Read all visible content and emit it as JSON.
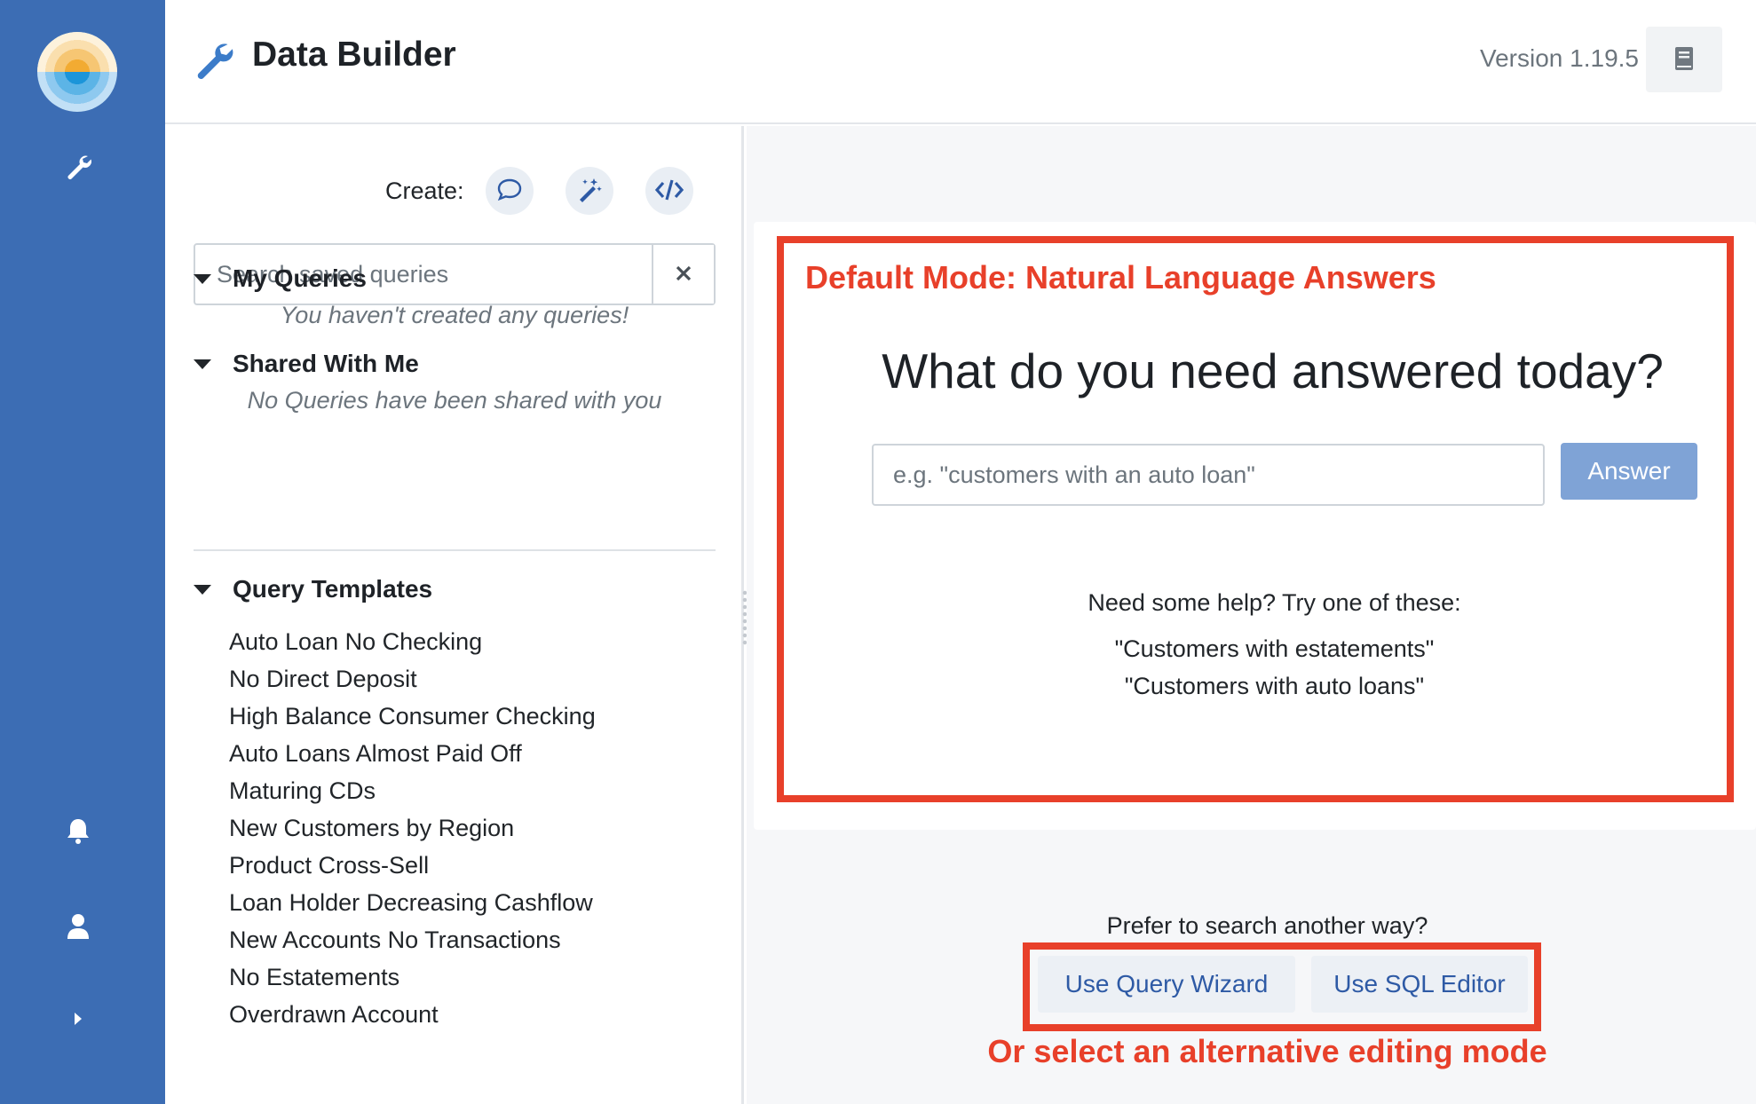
{
  "header": {
    "title": "Data Builder",
    "version": "Version 1.19.5"
  },
  "rail": {
    "icons": [
      "wrench-icon",
      "bell-icon",
      "user-icon",
      "chevron-right-icon"
    ]
  },
  "sidebar": {
    "create_label": "Create:",
    "create_buttons": [
      "chat-bubble-icon",
      "magic-wand-icon",
      "code-icon"
    ],
    "search_placeholder": "Search saved queries",
    "sections": [
      {
        "title": "My Queries",
        "empty_message": "You haven't created any queries!"
      },
      {
        "title": "Shared With Me",
        "empty_message": "No Queries have been shared with you"
      }
    ],
    "templates": {
      "title": "Query Templates",
      "items": [
        "Auto Loan No Checking",
        "No Direct Deposit",
        "High Balance Consumer Checking",
        "Auto Loans Almost Paid Off",
        "Maturing CDs",
        "New Customers by Region",
        "Product Cross-Sell",
        "Loan Holder Decreasing Cashflow",
        "New Accounts No Transactions",
        "No Estatements",
        "Overdrawn Account"
      ]
    }
  },
  "main": {
    "annotation_top": "Default Mode: Natural Language Answers",
    "question": "What do you need answered today?",
    "input_placeholder": "e.g. \"customers with an auto loan\"",
    "answer_label": "Answer",
    "help_text": "Need some help? Try one of these:",
    "examples": [
      "\"Customers with estatements\"",
      "\"Customers with auto loans\""
    ],
    "prefer_text": "Prefer to search another way?",
    "wizard_label": "Use Query Wizard",
    "sql_label": "Use SQL Editor",
    "annotation_bottom": "Or select an alternative editing mode"
  },
  "colors": {
    "rail": "#3c6db4",
    "accent": "#2e5aa5",
    "annotation": "#e8402a",
    "answer_button": "#7fa3d6"
  }
}
